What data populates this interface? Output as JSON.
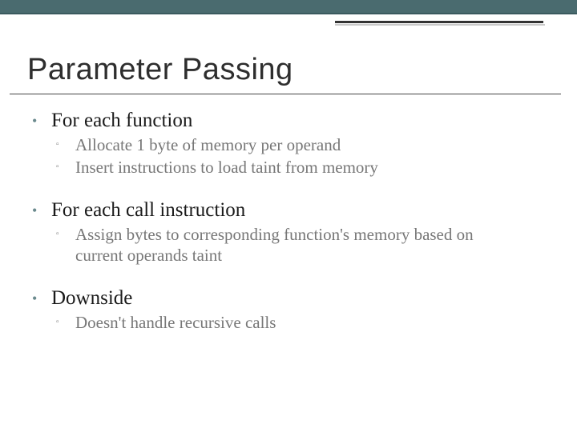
{
  "title": "Parameter Passing",
  "sections": [
    {
      "heading": "For each function",
      "items": [
        "Allocate 1 byte of memory per operand",
        "Insert instructions to load taint from memory"
      ]
    },
    {
      "heading": "For each call instruction",
      "items": [
        "Assign bytes to corresponding function's memory based on current operands taint"
      ]
    },
    {
      "heading": "Downside",
      "items": [
        "Doesn't handle recursive calls"
      ]
    }
  ]
}
